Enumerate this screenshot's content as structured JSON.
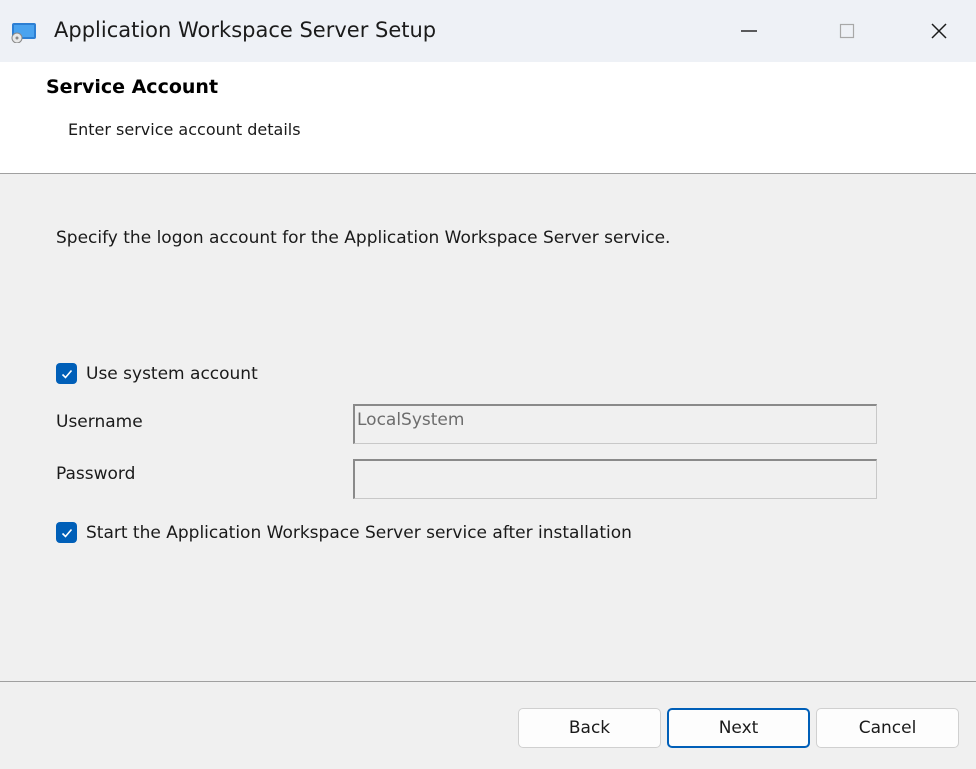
{
  "window": {
    "title": "Application Workspace Server Setup",
    "controls": [
      "minimize-icon",
      "maximize-icon",
      "close-icon"
    ]
  },
  "header": {
    "title": "Service Account",
    "subtitle": "Enter service account details"
  },
  "content": {
    "instruction": "Specify the logon account for the Application Workspace Server service.",
    "use_system_account": {
      "label": "Use system account",
      "checked": true
    },
    "username": {
      "label": "Username",
      "value": "LocalSystem",
      "disabled": true
    },
    "password": {
      "label": "Password",
      "value": "",
      "disabled": true
    },
    "start_service": {
      "label": "Start the Application Workspace Server service after installation",
      "checked": true
    }
  },
  "footer": {
    "back_label": "Back",
    "next_label": "Next",
    "cancel_label": "Cancel"
  },
  "colors": {
    "accent": "#005fb8",
    "background": "#f0f0f0",
    "titlebar": "#eef1f6"
  }
}
